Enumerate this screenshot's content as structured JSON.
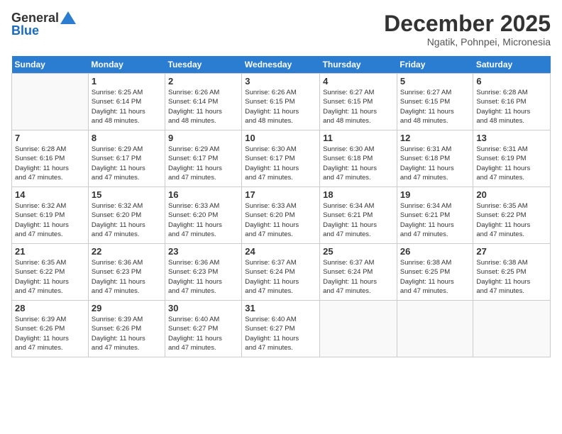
{
  "logo": {
    "general": "General",
    "blue": "Blue"
  },
  "header": {
    "month": "December 2025",
    "location": "Ngatik, Pohnpei, Micronesia"
  },
  "days_of_week": [
    "Sunday",
    "Monday",
    "Tuesday",
    "Wednesday",
    "Thursday",
    "Friday",
    "Saturday"
  ],
  "weeks": [
    [
      {
        "day": "",
        "info": ""
      },
      {
        "day": "1",
        "info": "Sunrise: 6:25 AM\nSunset: 6:14 PM\nDaylight: 11 hours\nand 48 minutes."
      },
      {
        "day": "2",
        "info": "Sunrise: 6:26 AM\nSunset: 6:14 PM\nDaylight: 11 hours\nand 48 minutes."
      },
      {
        "day": "3",
        "info": "Sunrise: 6:26 AM\nSunset: 6:15 PM\nDaylight: 11 hours\nand 48 minutes."
      },
      {
        "day": "4",
        "info": "Sunrise: 6:27 AM\nSunset: 6:15 PM\nDaylight: 11 hours\nand 48 minutes."
      },
      {
        "day": "5",
        "info": "Sunrise: 6:27 AM\nSunset: 6:15 PM\nDaylight: 11 hours\nand 48 minutes."
      },
      {
        "day": "6",
        "info": "Sunrise: 6:28 AM\nSunset: 6:16 PM\nDaylight: 11 hours\nand 48 minutes."
      }
    ],
    [
      {
        "day": "7",
        "info": "Sunrise: 6:28 AM\nSunset: 6:16 PM\nDaylight: 11 hours\nand 47 minutes."
      },
      {
        "day": "8",
        "info": "Sunrise: 6:29 AM\nSunset: 6:17 PM\nDaylight: 11 hours\nand 47 minutes."
      },
      {
        "day": "9",
        "info": "Sunrise: 6:29 AM\nSunset: 6:17 PM\nDaylight: 11 hours\nand 47 minutes."
      },
      {
        "day": "10",
        "info": "Sunrise: 6:30 AM\nSunset: 6:17 PM\nDaylight: 11 hours\nand 47 minutes."
      },
      {
        "day": "11",
        "info": "Sunrise: 6:30 AM\nSunset: 6:18 PM\nDaylight: 11 hours\nand 47 minutes."
      },
      {
        "day": "12",
        "info": "Sunrise: 6:31 AM\nSunset: 6:18 PM\nDaylight: 11 hours\nand 47 minutes."
      },
      {
        "day": "13",
        "info": "Sunrise: 6:31 AM\nSunset: 6:19 PM\nDaylight: 11 hours\nand 47 minutes."
      }
    ],
    [
      {
        "day": "14",
        "info": "Sunrise: 6:32 AM\nSunset: 6:19 PM\nDaylight: 11 hours\nand 47 minutes."
      },
      {
        "day": "15",
        "info": "Sunrise: 6:32 AM\nSunset: 6:20 PM\nDaylight: 11 hours\nand 47 minutes."
      },
      {
        "day": "16",
        "info": "Sunrise: 6:33 AM\nSunset: 6:20 PM\nDaylight: 11 hours\nand 47 minutes."
      },
      {
        "day": "17",
        "info": "Sunrise: 6:33 AM\nSunset: 6:20 PM\nDaylight: 11 hours\nand 47 minutes."
      },
      {
        "day": "18",
        "info": "Sunrise: 6:34 AM\nSunset: 6:21 PM\nDaylight: 11 hours\nand 47 minutes."
      },
      {
        "day": "19",
        "info": "Sunrise: 6:34 AM\nSunset: 6:21 PM\nDaylight: 11 hours\nand 47 minutes."
      },
      {
        "day": "20",
        "info": "Sunrise: 6:35 AM\nSunset: 6:22 PM\nDaylight: 11 hours\nand 47 minutes."
      }
    ],
    [
      {
        "day": "21",
        "info": "Sunrise: 6:35 AM\nSunset: 6:22 PM\nDaylight: 11 hours\nand 47 minutes."
      },
      {
        "day": "22",
        "info": "Sunrise: 6:36 AM\nSunset: 6:23 PM\nDaylight: 11 hours\nand 47 minutes."
      },
      {
        "day": "23",
        "info": "Sunrise: 6:36 AM\nSunset: 6:23 PM\nDaylight: 11 hours\nand 47 minutes."
      },
      {
        "day": "24",
        "info": "Sunrise: 6:37 AM\nSunset: 6:24 PM\nDaylight: 11 hours\nand 47 minutes."
      },
      {
        "day": "25",
        "info": "Sunrise: 6:37 AM\nSunset: 6:24 PM\nDaylight: 11 hours\nand 47 minutes."
      },
      {
        "day": "26",
        "info": "Sunrise: 6:38 AM\nSunset: 6:25 PM\nDaylight: 11 hours\nand 47 minutes."
      },
      {
        "day": "27",
        "info": "Sunrise: 6:38 AM\nSunset: 6:25 PM\nDaylight: 11 hours\nand 47 minutes."
      }
    ],
    [
      {
        "day": "28",
        "info": "Sunrise: 6:39 AM\nSunset: 6:26 PM\nDaylight: 11 hours\nand 47 minutes."
      },
      {
        "day": "29",
        "info": "Sunrise: 6:39 AM\nSunset: 6:26 PM\nDaylight: 11 hours\nand 47 minutes."
      },
      {
        "day": "30",
        "info": "Sunrise: 6:40 AM\nSunset: 6:27 PM\nDaylight: 11 hours\nand 47 minutes."
      },
      {
        "day": "31",
        "info": "Sunrise: 6:40 AM\nSunset: 6:27 PM\nDaylight: 11 hours\nand 47 minutes."
      },
      {
        "day": "",
        "info": ""
      },
      {
        "day": "",
        "info": ""
      },
      {
        "day": "",
        "info": ""
      }
    ]
  ]
}
